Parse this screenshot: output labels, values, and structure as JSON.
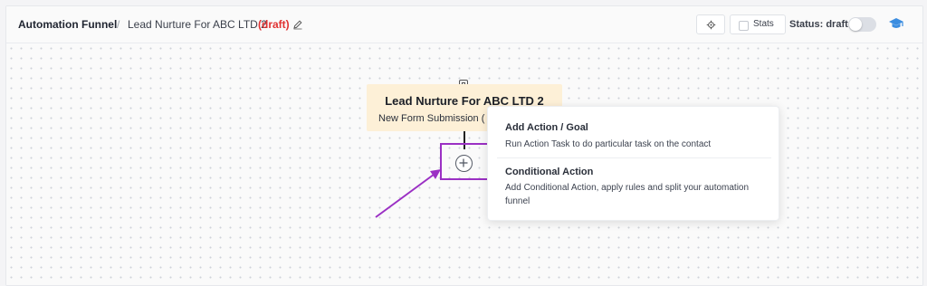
{
  "header": {
    "title": "Automation Funnel",
    "separator": "/",
    "funnel_name": "Lead Nurture For ABC LTD 2",
    "draft_label": "(draft)",
    "stats_label": "Stats",
    "status_label": "Status: draft",
    "status_enabled": false,
    "icons": {
      "edit": "pencil-icon",
      "settings": "gear-icon",
      "help": "graduation-cap-icon"
    }
  },
  "canvas": {
    "trigger": {
      "title": "Lead Nurture For ABC LTD 2",
      "subtitle": "New Form Submission ("
    },
    "add_button_icon": "plus-circle-icon"
  },
  "action_menu": {
    "items": [
      {
        "title": "Add Action / Goal",
        "description": "Run Action Task to do particular task on the contact"
      },
      {
        "title": "Conditional Action",
        "description": "Add Conditional Action, apply rules and split your automation funnel"
      }
    ]
  },
  "colors": {
    "draft": "#e03131",
    "trigger_card": "#fdf0d7",
    "highlight": "#9b30c4",
    "help_icon": "#3b8de0"
  }
}
